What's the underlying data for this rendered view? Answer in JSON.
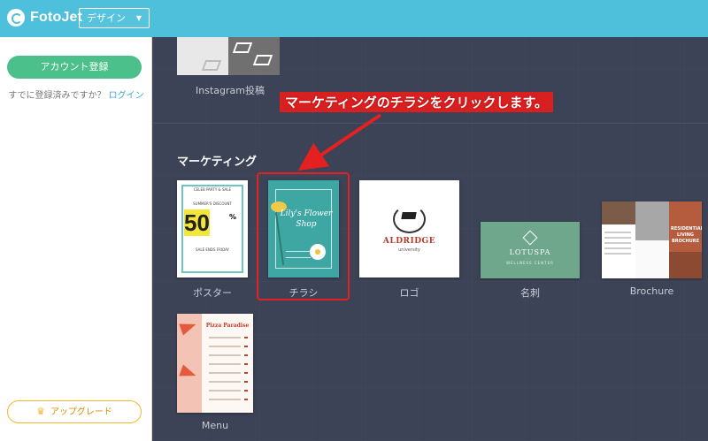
{
  "topbar": {
    "logo_text": "FotoJet",
    "design_select": {
      "value": "デザイン"
    }
  },
  "sidebar": {
    "register_label": "アカウント登録",
    "login_prompt": "すでに登録済みですか？",
    "login_link": "ログイン",
    "upgrade_label": "アップグレード"
  },
  "main": {
    "instagram_label": "Instagram投稿",
    "section_title": "マーケティング",
    "cards": [
      {
        "label": "ポスター"
      },
      {
        "label": "チラシ"
      },
      {
        "label": "ロゴ"
      },
      {
        "label": "名刺"
      },
      {
        "label": "Brochure"
      },
      {
        "label": "Menu"
      }
    ],
    "thumbs": {
      "poster": {
        "head": "CELEB PARTY & SALE",
        "sub": "SUMMER'S DISCOUNT",
        "big": "50",
        "pct": "%",
        "small": "SALE ENDS FRIDAY"
      },
      "flyer": {
        "title": "Lily's Flower Shop"
      },
      "logo": {
        "name": "ALDRIDGE",
        "sub": "university"
      },
      "bizcard": {
        "name": "LOTUSPA",
        "sub": "WELLNESS CENTER"
      },
      "brochure": {
        "title": "RESIDENTIAL LIVING BROCHURE"
      },
      "menu": {
        "title": "Pizza Paradise"
      }
    }
  },
  "annotation": {
    "text": "マーケティングのチラシをクリックします。",
    "color": "#d92020"
  },
  "colors": {
    "topbar": "#4fc0dc",
    "main_bg": "#3c4356",
    "register_button": "#4cc08a",
    "upgrade_border": "#f1b72f",
    "highlight_box": "#e52020"
  }
}
